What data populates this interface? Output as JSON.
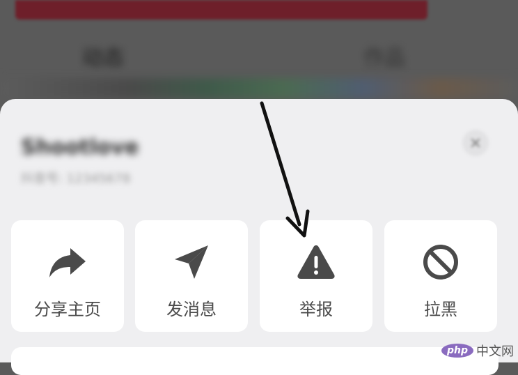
{
  "background": {
    "tab_left": "动态",
    "tab_right": "作品"
  },
  "profile": {
    "name": "Shootlove",
    "subtitle": "抖音号: 12345678"
  },
  "actions": [
    {
      "label": "分享主页",
      "icon": "share-arrow-icon"
    },
    {
      "label": "发消息",
      "icon": "paper-plane-icon"
    },
    {
      "label": "举报",
      "icon": "warning-triangle-icon"
    },
    {
      "label": "拉黑",
      "icon": "block-icon"
    }
  ],
  "watermark": {
    "logo": "php",
    "text": "中文网"
  },
  "colors": {
    "icon": "#4a4a4a",
    "sheet": "#efeff1",
    "card": "#ffffff",
    "annotation_arrow": "#111111"
  }
}
